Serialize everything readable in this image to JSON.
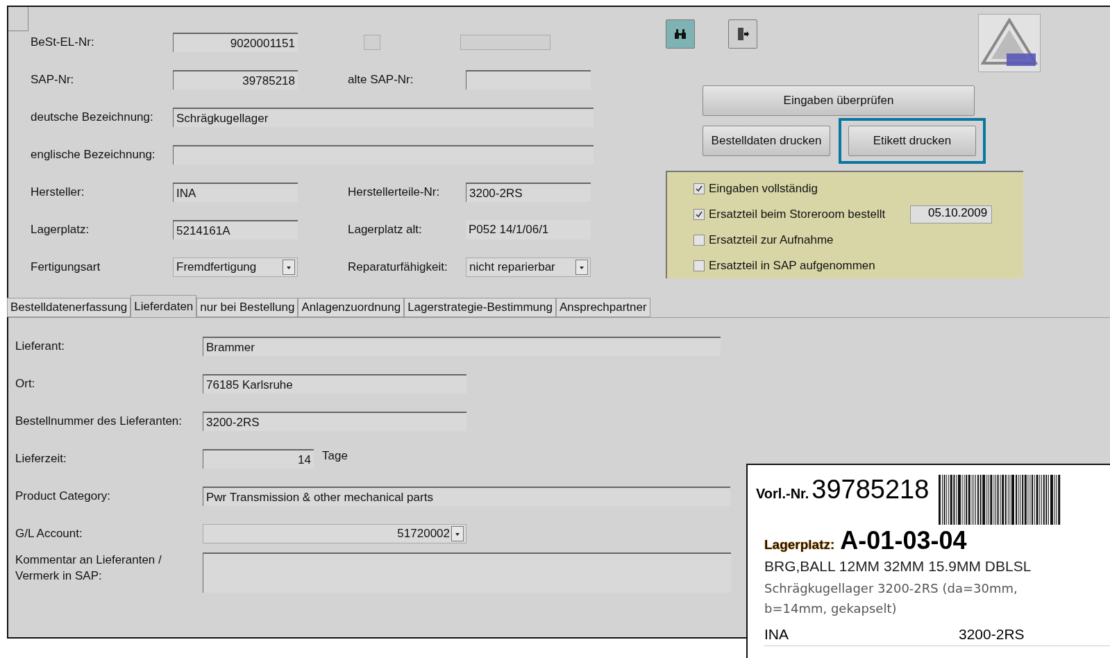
{
  "top_rows": [
    [
      {
        "label": "BeSt-EL-Nr:",
        "value": "9020001151",
        "kind": "number"
      }
    ],
    [
      {
        "label": "SAP-Nr:",
        "value": "39785218",
        "kind": "number"
      },
      {
        "label": "alte SAP-Nr:",
        "kind": "text"
      }
    ],
    [
      {
        "label": "deutsche Bezeichnung:",
        "value": "Schrägkugellager",
        "kind": "wide"
      }
    ],
    [
      {
        "label": "englische Bezeichnung:",
        "kind": "wide"
      }
    ],
    [
      {
        "label": "Hersteller:",
        "value": "INA",
        "kind": "text"
      },
      {
        "label": "Herstellerteile-Nr:",
        "value": "3200-2RS",
        "kind": "text"
      }
    ],
    [
      {
        "label": "Lagerplatz:",
        "value": "5214161A",
        "kind": "text"
      },
      {
        "label": "Lagerplatz alt:",
        "value": "P052 14/1/06/1",
        "kind": "readonly"
      }
    ],
    [
      {
        "label": "Fertigungsart",
        "value": "Fremdfertigung",
        "kind": "select"
      },
      {
        "label": "Reparaturfähigkeit:",
        "value": "nicht reparierbar",
        "kind": "select"
      }
    ]
  ],
  "buttons": [
    {
      "label": "Eingaben überprüfen",
      "kind": "wide",
      "highlighted": false
    },
    {
      "label": "Bestelldaten drucken",
      "kind": "half",
      "highlighted": false
    },
    {
      "label": "Etikett drucken",
      "kind": "half",
      "highlighted": true
    }
  ],
  "status_checks": [
    {
      "label": "Eingaben vollständig",
      "checked": true
    },
    {
      "label": "Ersatzteil beim Storeroom bestellt",
      "checked": true,
      "date": "05.10.2009"
    },
    {
      "label": "Ersatzteil zur Aufnahme",
      "checked": false
    },
    {
      "label": "Ersatzteil in SAP aufgenommen",
      "checked": false
    }
  ],
  "tabs": [
    {
      "label": "Bestelldatenerfassung",
      "selected": false
    },
    {
      "label": "Lieferdaten",
      "selected": true
    },
    {
      "label": "nur bei Bestellung",
      "selected": false
    },
    {
      "label": "Anlagenzuordnung",
      "selected": false
    },
    {
      "label": "Lagerstrategie-Bestimmung",
      "selected": false
    },
    {
      "label": "Ansprechpartner",
      "selected": false
    }
  ],
  "supplier_fields": [
    {
      "label": "Lieferant:",
      "value": "Brammer",
      "kind": "text"
    },
    {
      "label": "Ort:",
      "value": "76185 Karlsruhe",
      "kind": "text"
    },
    {
      "label": "Bestellnummer des Lieferanten:",
      "value": "3200-2RS",
      "kind": "text"
    },
    {
      "label": "Lieferzeit:",
      "value": "14",
      "kind": "number",
      "unit": "Tage"
    },
    {
      "label": "Product Category:",
      "value": "Pwr Transmission & other mechanical parts",
      "kind": "text"
    },
    {
      "label": "G/L Account:",
      "value": "51720002",
      "kind": "select"
    },
    {
      "label": "Kommentar an Lieferanten / Vermerk in SAP:",
      "kind": "multiline"
    }
  ],
  "label_card": {
    "number_label": "Vorl.-Nr.",
    "number": "39785218",
    "location_label": "Lagerplatz:",
    "location": "A-01-03-04",
    "description_en": "BRG,BALL 12MM 32MM 15.9MM DBLSL",
    "description_de": "Schrägkugellager 3200-2RS (da=30mm, b=14mm, gekapselt)",
    "manufacturer": "INA",
    "part_number": "3200-2RS"
  }
}
